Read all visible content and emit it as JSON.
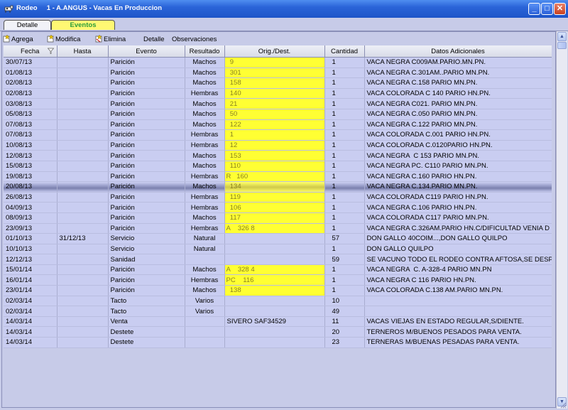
{
  "window": {
    "app_name": "Rodeo",
    "title": "1 - A.ANGUS - Vacas En Produccion",
    "minimize_glyph": "_",
    "maximize_glyph": "□",
    "close_glyph": "✕",
    "icons": {
      "app": "cow-icon"
    }
  },
  "tabs": [
    {
      "label": "Detalle",
      "active": false
    },
    {
      "label": "Eventos",
      "active": true
    }
  ],
  "toolbar": {
    "agrega": "Agrega",
    "modifica": "Modifica",
    "elimina": "Elimina",
    "detalle": "Detalle",
    "observaciones": "Observaciones"
  },
  "columns": {
    "fecha": "Fecha",
    "hasta": "Hasta",
    "evento": "Evento",
    "resultado": "Resultado",
    "orig_dest": "Orig./Dest.",
    "cantidad": "Cantidad",
    "datos": "Datos Adicionales"
  },
  "rows": [
    {
      "fecha": "30/07/13",
      "hasta": "",
      "evento": "Parición",
      "resultado": "Machos",
      "orig": "  9",
      "highlight": true,
      "cantidad": "1",
      "datos": "VACA NEGRA C009AM.PARIO.MN.PN."
    },
    {
      "fecha": "01/08/13",
      "hasta": "",
      "evento": "Parición",
      "resultado": "Machos",
      "orig": "  301",
      "highlight": true,
      "cantidad": "1",
      "datos": "VACA NEGRA C.301AM..PARIO MN.PN."
    },
    {
      "fecha": "02/08/13",
      "hasta": "",
      "evento": "Parición",
      "resultado": "Machos",
      "orig": "  158",
      "highlight": true,
      "cantidad": "1",
      "datos": "VACA NEGRA C.158 PARIO MN.PN."
    },
    {
      "fecha": "02/08/13",
      "hasta": "",
      "evento": "Parición",
      "resultado": "Hembras",
      "orig": "  140",
      "highlight": true,
      "cantidad": "1",
      "datos": "VACA COLORADA C 140 PARIO HN.PN."
    },
    {
      "fecha": "03/08/13",
      "hasta": "",
      "evento": "Parición",
      "resultado": "Machos",
      "orig": "  21",
      "highlight": true,
      "cantidad": "1",
      "datos": "VACA NEGRA C021. PARIO MN.PN."
    },
    {
      "fecha": "05/08/13",
      "hasta": "",
      "evento": "Parición",
      "resultado": "Machos",
      "orig": "  50",
      "highlight": true,
      "cantidad": "1",
      "datos": "VACA NEGRA C.050 PARIO MN.PN."
    },
    {
      "fecha": "07/08/13",
      "hasta": "",
      "evento": "Parición",
      "resultado": "Machos",
      "orig": "  122",
      "highlight": true,
      "cantidad": "1",
      "datos": "VACA NEGRA C.122 PARIO MN.PN."
    },
    {
      "fecha": "07/08/13",
      "hasta": "",
      "evento": "Parición",
      "resultado": "Hembras",
      "orig": "  1",
      "highlight": true,
      "cantidad": "1",
      "datos": "VACA COLORADA C.001 PARIO HN.PN."
    },
    {
      "fecha": "10/08/13",
      "hasta": "",
      "evento": "Parición",
      "resultado": "Hembras",
      "orig": "  12",
      "highlight": true,
      "cantidad": "1",
      "datos": "VACA COLORADA C.0120PARIO HN.PN."
    },
    {
      "fecha": "12/08/13",
      "hasta": "",
      "evento": "Parición",
      "resultado": "Machos",
      "orig": "  153",
      "highlight": true,
      "cantidad": "1",
      "datos": "VACA NEGRA  C 153 PARIO MN.PN."
    },
    {
      "fecha": "15/08/13",
      "hasta": "",
      "evento": "Parición",
      "resultado": "Machos",
      "orig": "  110",
      "highlight": true,
      "cantidad": "1",
      "datos": "VACA NEGRA PC. C110 PARIO MN.PN."
    },
    {
      "fecha": "19/08/13",
      "hasta": "",
      "evento": "Parición",
      "resultado": "Hembras",
      "orig": "R   160",
      "highlight": true,
      "cantidad": "1",
      "datos": "VACA NEGRA C.160 PARIO HN.PN."
    },
    {
      "fecha": "20/08/13",
      "hasta": "",
      "evento": "Parición",
      "resultado": "Machos",
      "orig": "  134",
      "highlight": true,
      "selected": true,
      "cantidad": "1",
      "datos": "VACA NEGRA C.134.PARIO MN.PN."
    },
    {
      "fecha": "26/08/13",
      "hasta": "",
      "evento": "Parición",
      "resultado": "Hembras",
      "orig": "  119",
      "highlight": true,
      "cantidad": "1",
      "datos": "VACA COLORADA C119 PARIO HN.PN."
    },
    {
      "fecha": "04/09/13",
      "hasta": "",
      "evento": "Parición",
      "resultado": "Hembras",
      "orig": "  106",
      "highlight": true,
      "cantidad": "1",
      "datos": "VACA NEGRA C.106 PARIO HN.PN."
    },
    {
      "fecha": "08/09/13",
      "hasta": "",
      "evento": "Parición",
      "resultado": "Machos",
      "orig": "  117",
      "highlight": true,
      "cantidad": "1",
      "datos": "VACA COLORADA C117 PARIO MN.PN."
    },
    {
      "fecha": "23/09/13",
      "hasta": "",
      "evento": "Parición",
      "resultado": "Hembras",
      "orig": "A    326 8",
      "highlight": true,
      "cantidad": "1",
      "datos": "VACA NEGRA C.326AM.PARIO HN.C/DIFICULTAD VENIA D"
    },
    {
      "fecha": "01/10/13",
      "hasta": "31/12/13",
      "evento": "Servicio",
      "resultado": "Natural",
      "orig": "",
      "highlight": false,
      "cantidad": "57",
      "datos": "DON GALLO 40COIM...,DON GALLO QUILPO"
    },
    {
      "fecha": "10/10/13",
      "hasta": "",
      "evento": "Servicio",
      "resultado": "Natural",
      "orig": "",
      "highlight": false,
      "cantidad": "1",
      "datos": "DON GALLO QUILPO"
    },
    {
      "fecha": "12/12/13",
      "hasta": "",
      "evento": "Sanidad",
      "resultado": "",
      "orig": "",
      "highlight": false,
      "cantidad": "59",
      "datos": "SE VACUNO TODO EL RODEO CONTRA AFTOSA,SE DESP"
    },
    {
      "fecha": "15/01/14",
      "hasta": "",
      "evento": "Parición",
      "resultado": "Machos",
      "orig": "A    328 4",
      "highlight": true,
      "cantidad": "1",
      "datos": "VACA NEGRA  C. A-328-4 PARIO MN.PN"
    },
    {
      "fecha": "16/01/14",
      "hasta": "",
      "evento": "Parición",
      "resultado": "Hembras",
      "orig": "PC    116",
      "highlight": true,
      "cantidad": "1",
      "datos": "VACA NEGRA C 116 PARIO HN.PN."
    },
    {
      "fecha": "23/01/14",
      "hasta": "",
      "evento": "Parición",
      "resultado": "Machos",
      "orig": "  138",
      "highlight": true,
      "cantidad": "1",
      "datos": "VACA COLORADA C.138 AM.PARIO MN.PN."
    },
    {
      "fecha": "02/03/14",
      "hasta": "",
      "evento": "Tacto",
      "resultado": "Varios",
      "orig": "",
      "highlight": false,
      "cantidad": "10",
      "datos": ""
    },
    {
      "fecha": "02/03/14",
      "hasta": "",
      "evento": "Tacto",
      "resultado": "Varios",
      "orig": "",
      "highlight": false,
      "cantidad": "49",
      "datos": ""
    },
    {
      "fecha": "14/03/14",
      "hasta": "",
      "evento": "Venta",
      "resultado": "",
      "orig": "SIVERO SAF34529",
      "highlight": false,
      "cantidad": "11",
      "datos": "VACAS VIEJAS EN ESTADO REGULAR,S/DIENTE."
    },
    {
      "fecha": "14/03/14",
      "hasta": "",
      "evento": "Destete",
      "resultado": "",
      "orig": "",
      "highlight": false,
      "cantidad": "20",
      "datos": "TERNEROS M/BUENOS PESADOS PARA VENTA."
    },
    {
      "fecha": "14/03/14",
      "hasta": "",
      "evento": "Destete",
      "resultado": "",
      "orig": "",
      "highlight": false,
      "cantidad": "23",
      "datos": "TERNERAS M/BUENAS PESADAS PARA VENTA."
    }
  ],
  "scrollbar": {
    "up_glyph": "▲",
    "down_glyph": "▼"
  },
  "colors": {
    "highlight": "#ffff33",
    "row_bg": "#c9cdf1",
    "title_bar": "#2a64d8"
  }
}
